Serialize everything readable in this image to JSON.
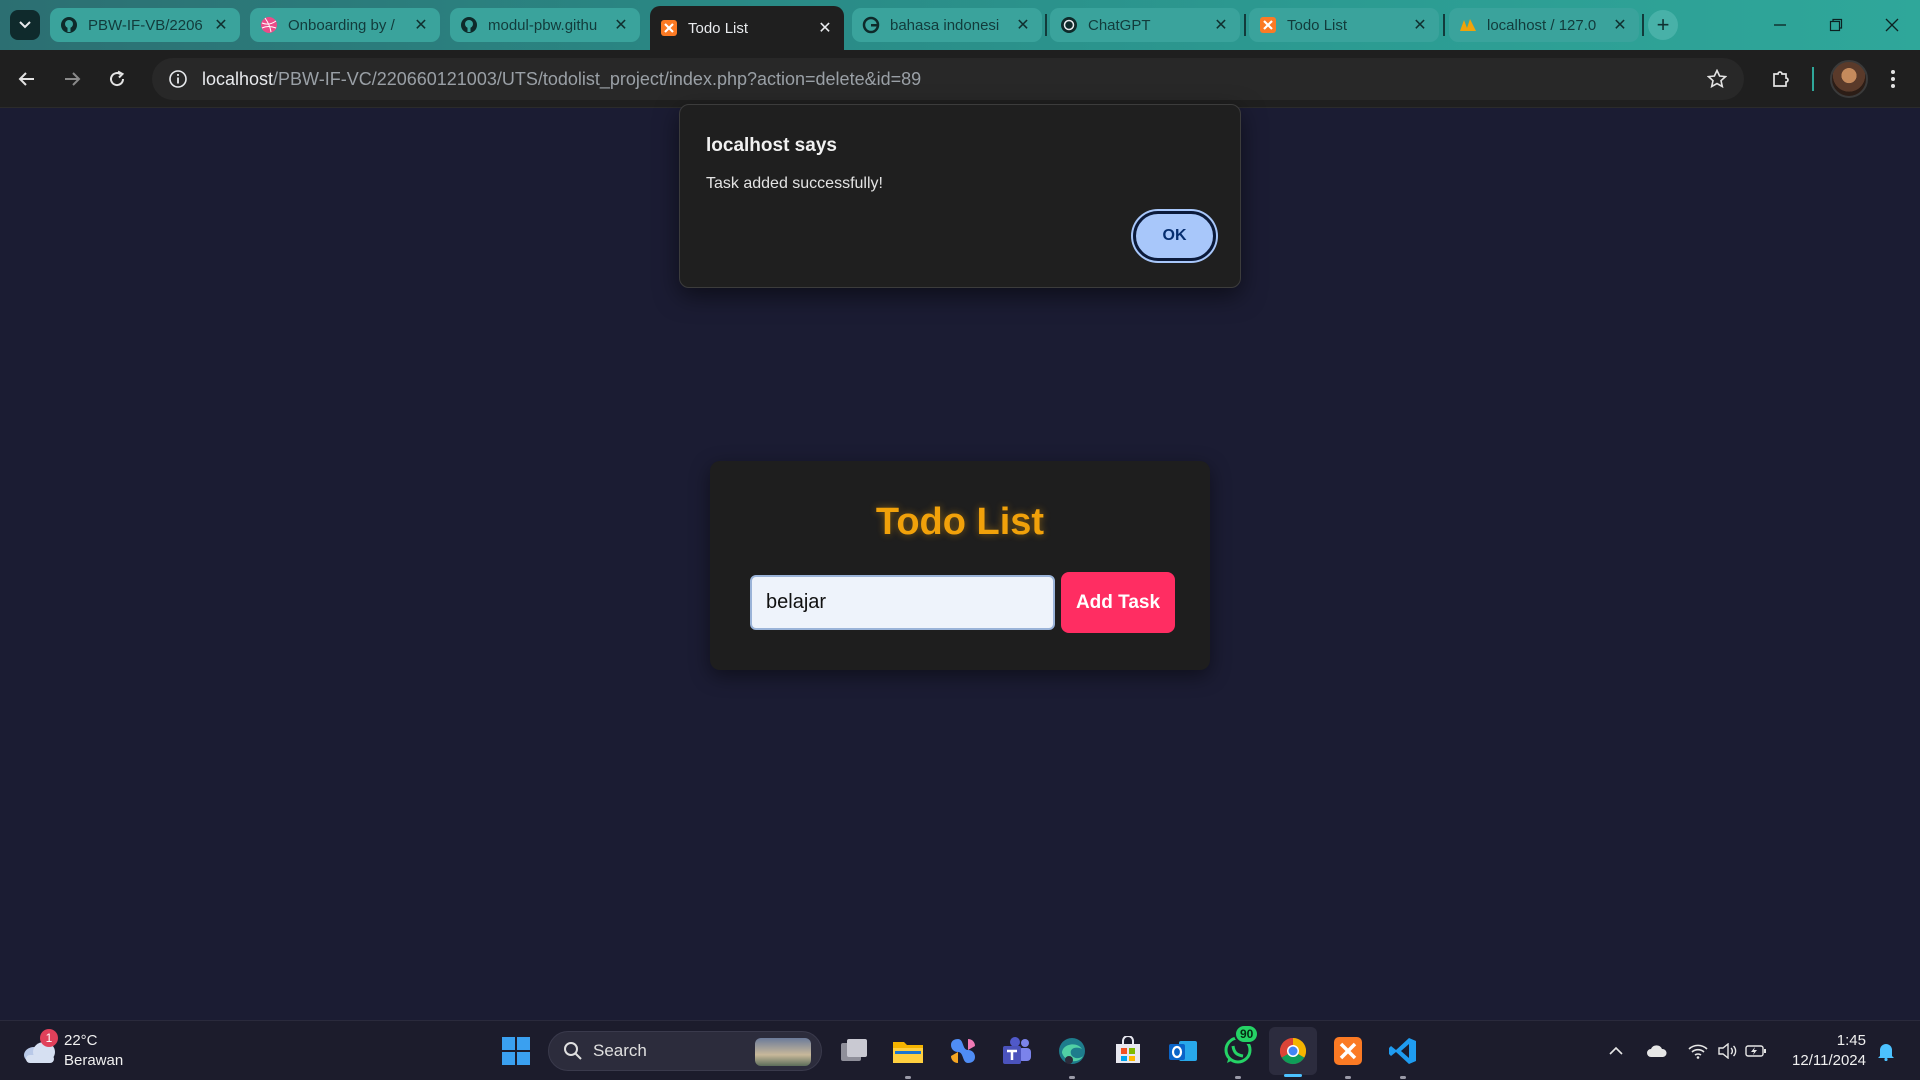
{
  "browser": {
    "tabs": [
      {
        "title": "PBW-IF-VB/2206",
        "icon": "github-icon",
        "active": false
      },
      {
        "title": "Onboarding by /",
        "icon": "dribbble-icon",
        "active": false
      },
      {
        "title": "modul-pbw.githu",
        "icon": "github-icon",
        "active": false
      },
      {
        "title": "Todo List",
        "icon": "xampp-icon",
        "active": true
      },
      {
        "title": "bahasa indonesi",
        "icon": "google-icon",
        "active": false
      },
      {
        "title": "ChatGPT",
        "icon": "chatgpt-icon",
        "active": false
      },
      {
        "title": "Todo List",
        "icon": "xampp-icon",
        "active": false
      },
      {
        "title": "localhost / 127.0",
        "icon": "phpmyadmin-icon",
        "active": false
      }
    ],
    "close_glyph": "✕",
    "new_tab_glyph": "+",
    "url_host": "localhost",
    "url_rest": "/PBW-IF-VC/220660121003/UTS/todolist_project/index.php?action=delete&id=89"
  },
  "alert": {
    "title": "localhost says",
    "message": "Task added successfully!",
    "ok_label": "OK"
  },
  "todo": {
    "title": "Todo List",
    "input_value": "belajar",
    "add_label": "Add Task",
    "title_color": "#f1a10a",
    "button_color": "#ff2d62"
  },
  "taskbar": {
    "weather_temp": "22°C",
    "weather_desc": "Berawan",
    "weather_badge": "1",
    "search_label": "Search",
    "whatsapp_badge": "90",
    "time": "1:45",
    "date": "12/11/2024"
  }
}
